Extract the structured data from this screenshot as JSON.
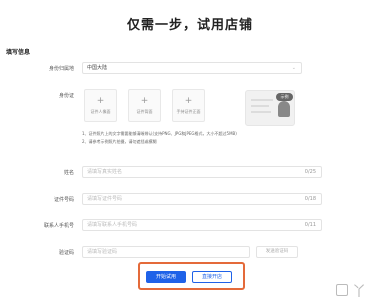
{
  "page_title": "仅需一步，试用店铺",
  "section_title": "填写信息",
  "region": {
    "label": "身份归属地",
    "value": "中国大陆"
  },
  "id_card": {
    "label": "身份证",
    "uploads": [
      {
        "caption": "证件人像面"
      },
      {
        "caption": "证件背面"
      },
      {
        "caption": "手持证件正面"
      }
    ],
    "sample_badge": "示例",
    "notes": [
      "1、证件照片上的文字需要能够清晰辨认(支持PNG、JPG和JPEG格式，大小不超过5MB)",
      "2、请参考示例照片拍摄，请勿遮挡或模糊"
    ]
  },
  "fields": {
    "name": {
      "label": "姓名",
      "placeholder": "请填写真实姓名",
      "count": "0/25"
    },
    "id_number": {
      "label": "证件号码",
      "placeholder": "请填写证件号码",
      "count": "0/18"
    },
    "phone": {
      "label": "联系人手机号",
      "placeholder": "请填写联系人手机号码",
      "count": "0/11"
    },
    "code": {
      "label": "验证码",
      "placeholder": "请填写验证码",
      "button": "发送验证码"
    }
  },
  "actions": {
    "start_trial": "开始试用",
    "open_directly": "直接开店"
  },
  "watermark": "丫"
}
